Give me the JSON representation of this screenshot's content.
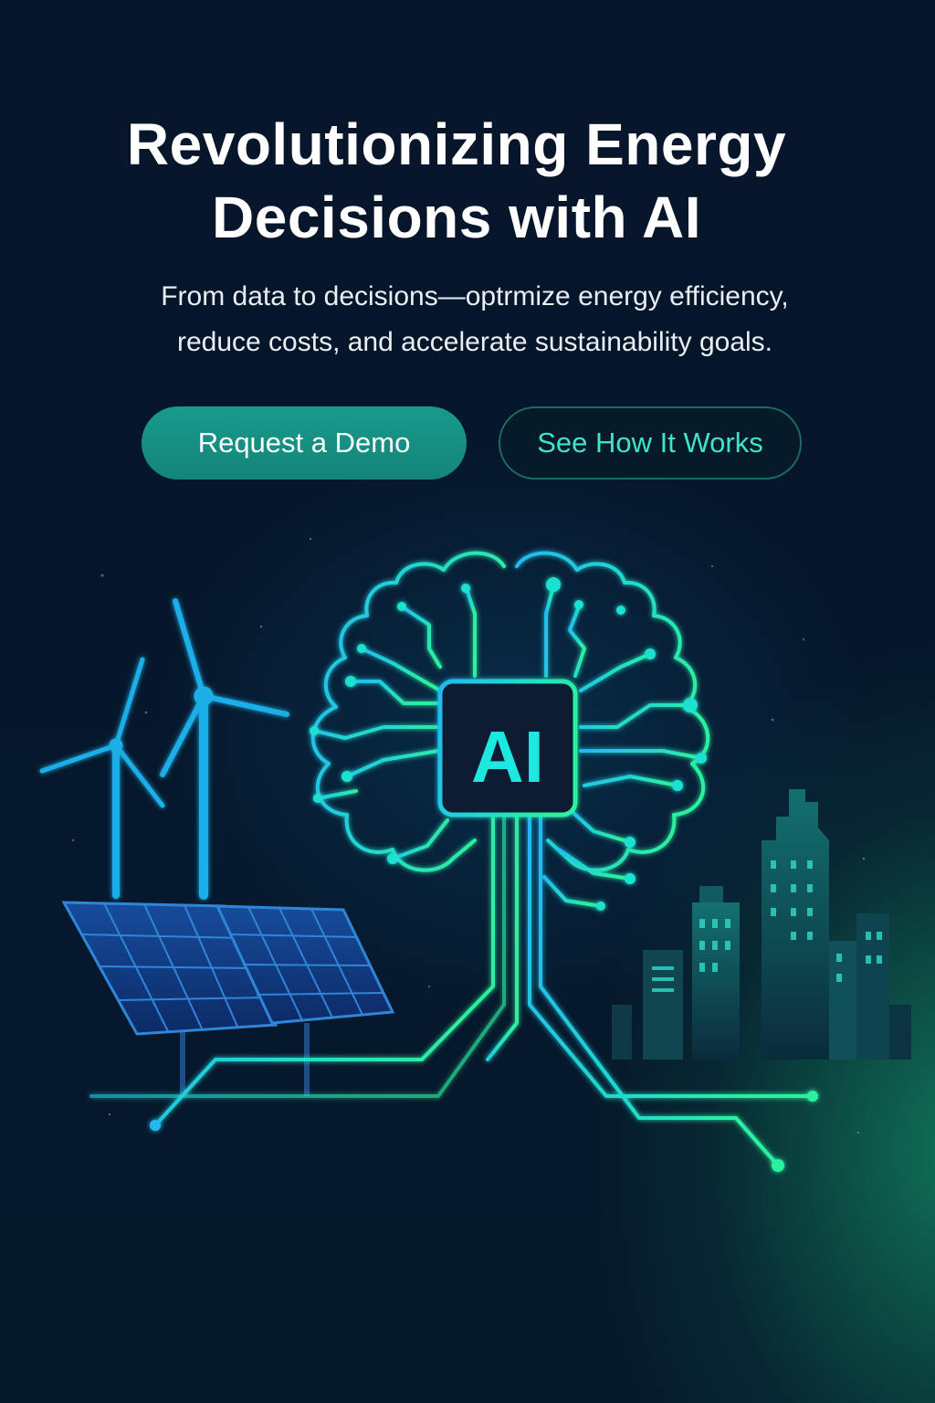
{
  "hero": {
    "headline_line1": "Revolutionizing Energy",
    "headline_line2": "Decisions with AI",
    "subtext_line1": "From data to decisions—optrmize energy efficiency,",
    "subtext_line2": "reduce costs, and accelerate sustainability goals."
  },
  "buttons": {
    "primary_label": "Request a Demo",
    "secondary_label": "See How It Works"
  },
  "illustration": {
    "chip_label": "AI",
    "icons": [
      "wind-turbine-icon",
      "solar-panel-icon",
      "brain-circuit-icon",
      "city-skyline-icon"
    ]
  },
  "colors": {
    "background": "#07162a",
    "accent_teal": "#199a8c",
    "accent_green": "#3fe4c8",
    "cyan_glow": "#1ed0f0"
  }
}
